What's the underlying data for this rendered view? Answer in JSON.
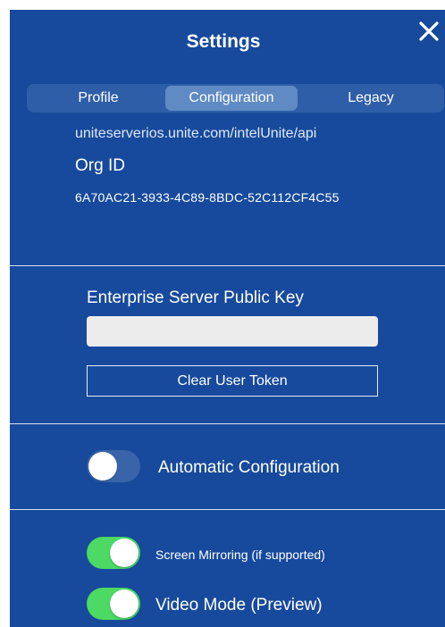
{
  "header": {
    "title": "Settings",
    "close_icon": "close-x-icon"
  },
  "tabs": [
    {
      "label": "Profile",
      "active": false
    },
    {
      "label": "Configuration",
      "active": true
    },
    {
      "label": "Legacy",
      "active": false
    }
  ],
  "configuration": {
    "server_url_partial": "uniteserverios.unite.com/intelUnite/api",
    "org_id_label": "Org ID",
    "org_id_value": "6A70AC21-3933-4C89-8BDC-52C112CF4C55",
    "public_key_label": "Enterprise Server Public Key",
    "public_key_value": "",
    "clear_token_label": "Clear User Token",
    "auto_config": {
      "label": "Automatic Configuration",
      "enabled": false
    },
    "screen_mirroring": {
      "label": "Screen Mirroring (if supported)",
      "enabled": true
    },
    "video_mode": {
      "label": "Video Mode (Preview)",
      "enabled": true
    }
  },
  "colors": {
    "panel_bg": "#174a9c",
    "segment_bg": "#2f5ea8",
    "segment_active": "#5f8ac4",
    "toggle_on": "#4cd964"
  }
}
